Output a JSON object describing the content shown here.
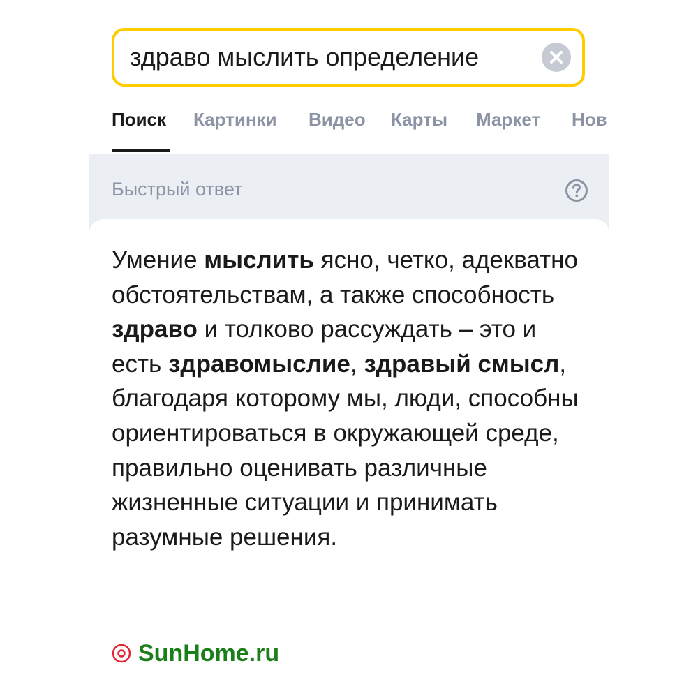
{
  "search": {
    "query": "здраво мыслить определение"
  },
  "tabs": [
    {
      "label": "Поиск",
      "active": true
    },
    {
      "label": "Картинки",
      "active": false
    },
    {
      "label": "Видео",
      "active": false
    },
    {
      "label": "Карты",
      "active": false
    },
    {
      "label": "Маркет",
      "active": false
    },
    {
      "label": "Нов",
      "active": false
    }
  ],
  "quick_answer": {
    "title": "Быстрый ответ",
    "segments": [
      {
        "text": "Умение ",
        "bold": false
      },
      {
        "text": "мыслить",
        "bold": true
      },
      {
        "text": " ясно, четко, адекватно обстоятельствам, а также способность ",
        "bold": false
      },
      {
        "text": "здраво",
        "bold": true
      },
      {
        "text": " и толково рассуждать – это и есть ",
        "bold": false
      },
      {
        "text": "здравомыслие",
        "bold": true
      },
      {
        "text": ", ",
        "bold": false
      },
      {
        "text": "здравый смысл",
        "bold": true
      },
      {
        "text": ", благодаря которому мы, люди, способны ориентироваться в окружающей среде, правильно оценивать различные жизненные ситуации и принимать разумные решения.",
        "bold": false
      }
    ],
    "source": {
      "name": "SunHome.ru",
      "icon": "sunhome-logo-icon"
    }
  },
  "colors": {
    "search_border": "#ffcc00",
    "tab_inactive": "#8c93a5",
    "tab_active": "#1a1a1a",
    "quick_answer_bg": "#ebeef3",
    "source_red": "#e32636",
    "source_green": "#1a7f1a"
  }
}
